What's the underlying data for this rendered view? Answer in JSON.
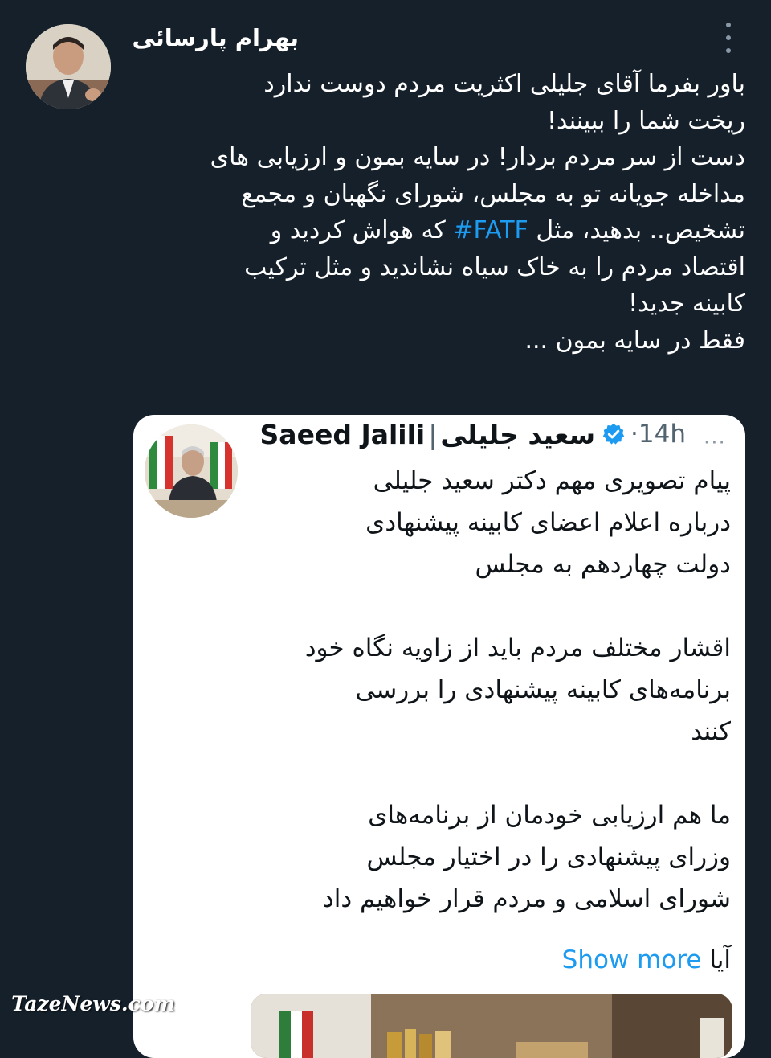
{
  "tweet": {
    "author_name": "بهرام پارسائی",
    "lines": [
      "باور بفرما آقای جلیلی اکثریت مردم دوست ندارد",
      "ریخت شما را ببینند!",
      "دست از سر مردم بردار! در سایه بمون و ارزیابی های",
      "مداخله جویانه تو به مجلس، شورای نگهبان و مجمع"
    ],
    "line5_before": "تشخیص.. بدهید، مثل ",
    "hashtag": "#FATF",
    "line5_after": " که هواش کردید و",
    "lines_after": [
      "اقتصاد مردم را به خاک سیاه نشاندید و مثل ترکیب",
      "کابینه جدید!",
      "فقط در سایه بمون ..."
    ],
    "icons": {
      "avatar": "avatar-photo",
      "more": "more-vertical-icon"
    }
  },
  "quote": {
    "name_fa": "سعید جلیلی",
    "separator": "|",
    "name_en": "Saeed Jalili",
    "time": "·14h",
    "more_icon": "···",
    "paragraphs": [
      [
        "پیام تصویری مهم دکتر سعید جلیلی",
        "درباره اعلام اعضای کابینه پیشنهادی",
        "دولت چهاردهم به مجلس"
      ],
      [
        "اقشار مختلف مردم باید از زاویه نگاه خود",
        "برنامه‌های کابینه پیشنهادی را بررسی",
        "کنند"
      ],
      [
        "ما هم ارزیابی خودمان از برنامه‌های",
        "وزرای پیشنهادی را در اختیار مجلس",
        "شورای اسلامی و مردم قرار خواهیم داد"
      ]
    ],
    "truncated_word": "آیا",
    "show_more": "Show more",
    "icons": {
      "verified": "verified-badge-icon",
      "avatar": "avatar-photo",
      "media": "media-preview"
    }
  },
  "watermark": "TazeNews.com",
  "colors": {
    "background": "#15202b",
    "card": "#ffffff",
    "link": "#1d9bf0",
    "muted": "#536471"
  }
}
